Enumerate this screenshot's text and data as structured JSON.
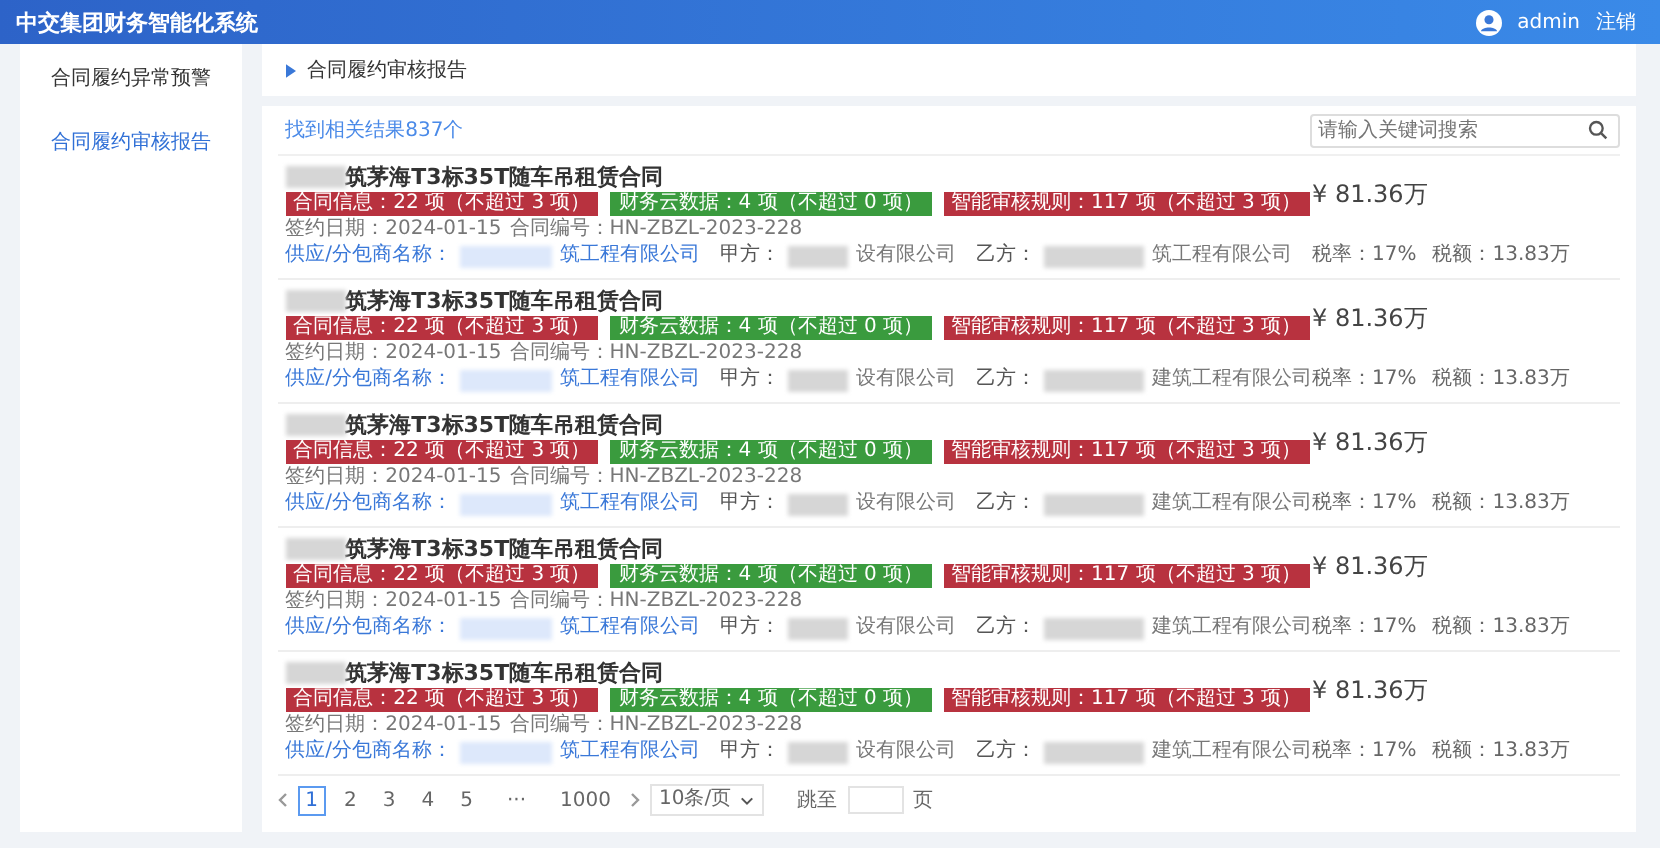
{
  "header": {
    "title": "中交集团财务智能化系统",
    "user": "admin",
    "logout": "注销"
  },
  "sidebar": {
    "items": [
      {
        "label": "合同履约异常预警",
        "selected": false
      },
      {
        "label": "合同履约审核报告",
        "selected": true
      }
    ]
  },
  "breadcrumb": "合同履约审核报告",
  "results": {
    "summary": "找到相关结果837个",
    "search": {
      "placeholder": "请输入关键词搜索"
    },
    "rows": [
      {
        "title": "筑茅海T3标35T随车吊租赁合同",
        "tags": [
          {
            "text": "合同信息：22 项（不超过 3 项）",
            "color": "#b8323f"
          },
          {
            "text": "财务云数据：4 项（不超过 0 项）",
            "color": "#3a9b3e"
          },
          {
            "text": "智能审核规则：117 项（不超过 3 项）",
            "color": "#b8323f"
          }
        ],
        "sign_date": "签约日期：2024-01-15",
        "contract_no": "合同编号：HN-ZBZL-2023-228",
        "supplier_label": "供应/分包商名称：",
        "supplier": "筑工程有限公司",
        "party_a_label": "甲方：",
        "party_a": "设有限公司",
        "party_b_label": "乙方：",
        "party_b": "筑工程有限公司",
        "amount": "¥ 81.36万",
        "tax_rate": "税率：17%",
        "tax": "税额：13.83万"
      },
      {
        "title": "筑茅海T3标35T随车吊租赁合同",
        "tags": [
          {
            "text": "合同信息：22 项（不超过 3 项）",
            "color": "#b8323f"
          },
          {
            "text": "财务云数据：4 项（不超过 0 项）",
            "color": "#3a9b3e"
          },
          {
            "text": "智能审核规则：117 项（不超过 3 项）",
            "color": "#b8323f"
          }
        ],
        "sign_date": "签约日期：2024-01-15",
        "contract_no": "合同编号：HN-ZBZL-2023-228",
        "supplier_label": "供应/分包商名称：",
        "supplier": "筑工程有限公司",
        "party_a_label": "甲方：",
        "party_a": "设有限公司",
        "party_b_label": "乙方：",
        "party_b": "建筑工程有限公司",
        "amount": "¥ 81.36万",
        "tax_rate": "税率：17%",
        "tax": "税额：13.83万"
      },
      {
        "title": "筑茅海T3标35T随车吊租赁合同",
        "tags": [
          {
            "text": "合同信息：22 项（不超过 3 项）",
            "color": "#b8323f"
          },
          {
            "text": "财务云数据：4 项（不超过 0 项）",
            "color": "#3a9b3e"
          },
          {
            "text": "智能审核规则：117 项（不超过 3 项）",
            "color": "#b8323f"
          }
        ],
        "sign_date": "签约日期：2024-01-15",
        "contract_no": "合同编号：HN-ZBZL-2023-228",
        "supplier_label": "供应/分包商名称：",
        "supplier": "筑工程有限公司",
        "party_a_label": "甲方：",
        "party_a": "设有限公司",
        "party_b_label": "乙方：",
        "party_b": "建筑工程有限公司",
        "amount": "¥ 81.36万",
        "tax_rate": "税率：17%",
        "tax": "税额：13.83万"
      },
      {
        "title": "筑茅海T3标35T随车吊租赁合同",
        "tags": [
          {
            "text": "合同信息：22 项（不超过 3 项）",
            "color": "#b8323f"
          },
          {
            "text": "财务云数据：4 项（不超过 0 项）",
            "color": "#3a9b3e"
          },
          {
            "text": "智能审核规则：117 项（不超过 3 项）",
            "color": "#b8323f"
          }
        ],
        "sign_date": "签约日期：2024-01-15",
        "contract_no": "合同编号：HN-ZBZL-2023-228",
        "supplier_label": "供应/分包商名称：",
        "supplier": "筑工程有限公司",
        "party_a_label": "甲方：",
        "party_a": "设有限公司",
        "party_b_label": "乙方：",
        "party_b": "建筑工程有限公司",
        "amount": "¥ 81.36万",
        "tax_rate": "税率：17%",
        "tax": "税额：13.83万"
      },
      {
        "title": "筑茅海T3标35T随车吊租赁合同",
        "tags": [
          {
            "text": "合同信息：22 项（不超过 3 项）",
            "color": "#b8323f"
          },
          {
            "text": "财务云数据：4 项（不超过 0 项）",
            "color": "#3a9b3e"
          },
          {
            "text": "智能审核规则：117 项（不超过 3 项）",
            "color": "#b8323f"
          }
        ],
        "sign_date": "签约日期：2024-01-15",
        "contract_no": "合同编号：HN-ZBZL-2023-228",
        "supplier_label": "供应/分包商名称：",
        "supplier": "筑工程有限公司",
        "party_a_label": "甲方：",
        "party_a": "设有限公司",
        "party_b_label": "乙方：",
        "party_b": "建筑工程有限公司",
        "amount": "¥ 81.36万",
        "tax_rate": "税率：17%",
        "tax": "税额：13.83万"
      }
    ]
  },
  "pagination": {
    "pages": [
      {
        "label": "1",
        "kind": "page",
        "selected": true
      },
      {
        "label": "2",
        "kind": "page",
        "selected": false
      },
      {
        "label": "3",
        "kind": "page",
        "selected": false
      },
      {
        "label": "4",
        "kind": "page",
        "selected": false
      },
      {
        "label": "5",
        "kind": "page",
        "selected": false
      },
      {
        "label": "···",
        "kind": "ellipsis"
      },
      {
        "label": "1000",
        "kind": "page",
        "selected": false
      }
    ],
    "page_size": "10条/页",
    "jump_label": "跳至",
    "jump_suffix": "页"
  }
}
